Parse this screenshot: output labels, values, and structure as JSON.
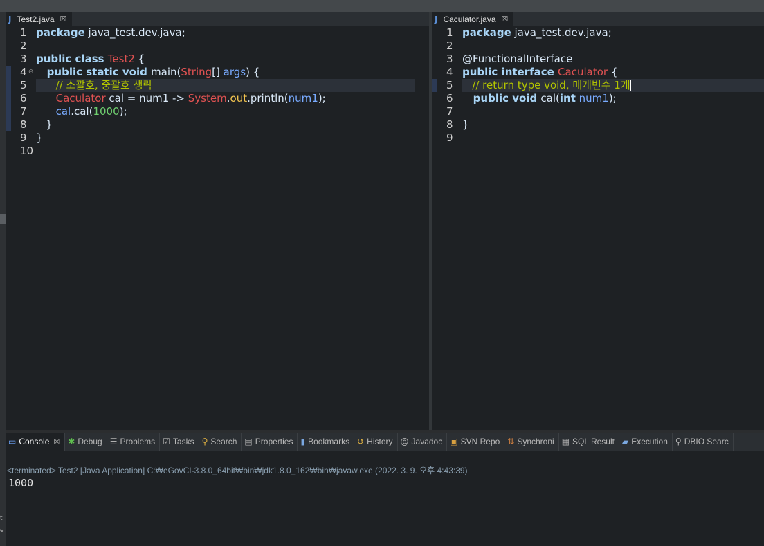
{
  "left_editor": {
    "tab_label": "Test2.java",
    "lines": [
      {
        "n": "1",
        "tokens": [
          {
            "t": "package",
            "c": "kw"
          },
          {
            "t": " java_test.dev.java;",
            "c": "id"
          }
        ]
      },
      {
        "n": "2",
        "tokens": []
      },
      {
        "n": "3",
        "tokens": [
          {
            "t": "public class ",
            "c": "kw"
          },
          {
            "t": "Test2",
            "c": "ty"
          },
          {
            "t": " {",
            "c": "id"
          }
        ]
      },
      {
        "n": "4",
        "fold": true,
        "tokens": [
          {
            "t": "   public static void ",
            "c": "kw"
          },
          {
            "t": "main(",
            "c": "id"
          },
          {
            "t": "String",
            "c": "ty"
          },
          {
            "t": "[] ",
            "c": "id"
          },
          {
            "t": "args",
            "c": "pv"
          },
          {
            "t": ") {",
            "c": "id"
          }
        ]
      },
      {
        "n": "5",
        "hl": true,
        "tokens": [
          {
            "t": "      // 소괄호, 중괄호 생략",
            "c": "cm"
          }
        ]
      },
      {
        "n": "6",
        "tokens": [
          {
            "t": "      ",
            "c": "id"
          },
          {
            "t": "Caculator",
            "c": "ty"
          },
          {
            "t": " cal = num1 -> ",
            "c": "id"
          },
          {
            "t": "System",
            "c": "st"
          },
          {
            "t": ".",
            "c": "id"
          },
          {
            "t": "out",
            "c": "fd"
          },
          {
            "t": ".println(",
            "c": "id"
          },
          {
            "t": "num1",
            "c": "pv"
          },
          {
            "t": ");",
            "c": "id"
          }
        ]
      },
      {
        "n": "7",
        "tokens": [
          {
            "t": "      ",
            "c": "id"
          },
          {
            "t": "cal",
            "c": "pv"
          },
          {
            "t": ".cal(",
            "c": "id"
          },
          {
            "t": "1000",
            "c": "nm"
          },
          {
            "t": ");",
            "c": "id"
          }
        ]
      },
      {
        "n": "8",
        "tokens": [
          {
            "t": "   }",
            "c": "id"
          }
        ]
      },
      {
        "n": "9",
        "tokens": [
          {
            "t": "}",
            "c": "id"
          }
        ]
      },
      {
        "n": "10",
        "tokens": []
      }
    ]
  },
  "right_editor": {
    "tab_label": "Caculator.java",
    "lines": [
      {
        "n": "1",
        "tokens": [
          {
            "t": "package",
            "c": "kw"
          },
          {
            "t": " java_test.dev.java;",
            "c": "id"
          }
        ]
      },
      {
        "n": "2",
        "tokens": []
      },
      {
        "n": "3",
        "tokens": [
          {
            "t": "@FunctionalInterface",
            "c": "ann"
          }
        ]
      },
      {
        "n": "4",
        "tokens": [
          {
            "t": "public interface ",
            "c": "kw"
          },
          {
            "t": "Caculator",
            "c": "ty"
          },
          {
            "t": " {",
            "c": "id"
          }
        ]
      },
      {
        "n": "5",
        "hl": true,
        "caret": true,
        "tokens": [
          {
            "t": "   // return type void, 매개변수 1개",
            "c": "cm"
          }
        ]
      },
      {
        "n": "6",
        "tokens": [
          {
            "t": "   public void ",
            "c": "kw"
          },
          {
            "t": "cal(",
            "c": "id"
          },
          {
            "t": "int",
            "c": "kw"
          },
          {
            "t": " ",
            "c": "id"
          },
          {
            "t": "num1",
            "c": "pv"
          },
          {
            "t": ");",
            "c": "id"
          }
        ]
      },
      {
        "n": "7",
        "tokens": []
      },
      {
        "n": "8",
        "tokens": [
          {
            "t": "}",
            "c": "id"
          }
        ]
      },
      {
        "n": "9",
        "tokens": []
      }
    ]
  },
  "views": [
    {
      "label": "Console",
      "icon": "console-icon",
      "glyph": "▭",
      "color": "#6fa8ff",
      "active": true
    },
    {
      "label": "Debug",
      "icon": "bug-icon",
      "glyph": "✱",
      "color": "#5fbf4f"
    },
    {
      "label": "Problems",
      "icon": "problems-icon",
      "glyph": "☰",
      "color": "#b0b0b0"
    },
    {
      "label": "Tasks",
      "icon": "tasks-icon",
      "glyph": "☑",
      "color": "#b0b0b0"
    },
    {
      "label": "Search",
      "icon": "search-icon",
      "glyph": "⚲",
      "color": "#e3b341"
    },
    {
      "label": "Properties",
      "icon": "properties-icon",
      "glyph": "▤",
      "color": "#b0b0b0"
    },
    {
      "label": "Bookmarks",
      "icon": "bookmark-icon",
      "glyph": "▮",
      "color": "#7aa7e0"
    },
    {
      "label": "History",
      "icon": "history-icon",
      "glyph": "↺",
      "color": "#e3b341"
    },
    {
      "label": "Javadoc",
      "icon": "javadoc-icon",
      "glyph": "@",
      "color": "#b0b0b0"
    },
    {
      "label": "SVN Repo",
      "icon": "svn-icon",
      "glyph": "▣",
      "color": "#d8a040"
    },
    {
      "label": "Synchroni",
      "icon": "synchronize-icon",
      "glyph": "⇅",
      "color": "#d08040"
    },
    {
      "label": "SQL Result",
      "icon": "table-icon",
      "glyph": "▦",
      "color": "#b0b0b0"
    },
    {
      "label": "Execution",
      "icon": "execution-icon",
      "glyph": "▰",
      "color": "#7aa7e0"
    },
    {
      "label": "DBIO Searc",
      "icon": "dbio-icon",
      "glyph": "⚲",
      "color": "#b0b0b0"
    }
  ],
  "console": {
    "terminated": "<terminated> Test2 [Java Application] C:₩eGovCI-3.8.0_64bit₩bin₩jdk1.8.0_162₩bin₩javaw.exe (2022. 3. 9. 오후 4:43:39)",
    "output": "1000"
  },
  "left_edge_fragments": [
    "t",
    "e"
  ]
}
